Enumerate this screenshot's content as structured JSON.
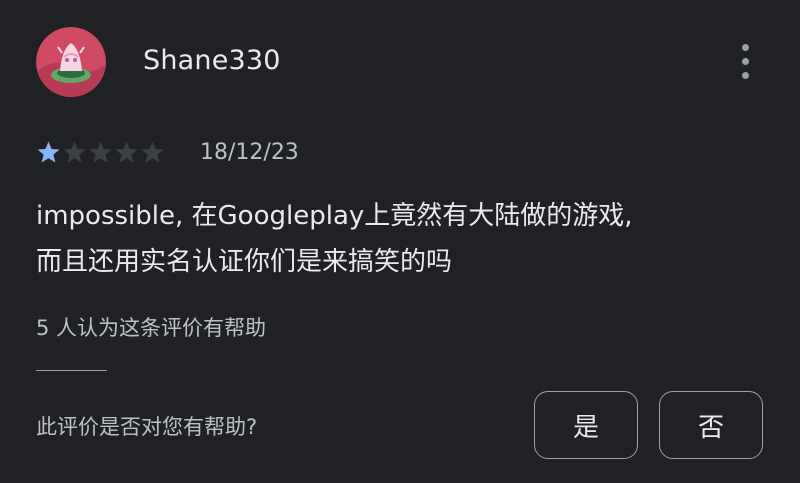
{
  "review": {
    "author": {
      "name": "Shane330",
      "avatar_icon": "user-avatar",
      "avatar_colors": {
        "background": "#d14a64",
        "accent": "#5fa869",
        "highlight": "#f2d6e8"
      }
    },
    "menu_icon": "more-vert-icon",
    "rating": {
      "value": 1,
      "max": 5,
      "filled_color": "#8ab4f8",
      "empty_color": "#3c4043"
    },
    "date": "18/12/23",
    "text_line_1": "impossible, 在Googleplay上竟然有大陆做的游戏,",
    "text_line_2": "而且还用实名认证你们是来搞笑的吗",
    "helpful_count_text": "5 人认为这条评价有帮助",
    "feedback": {
      "question": "此评价是否对您有帮助?",
      "yes_label": "是",
      "no_label": "否"
    }
  }
}
